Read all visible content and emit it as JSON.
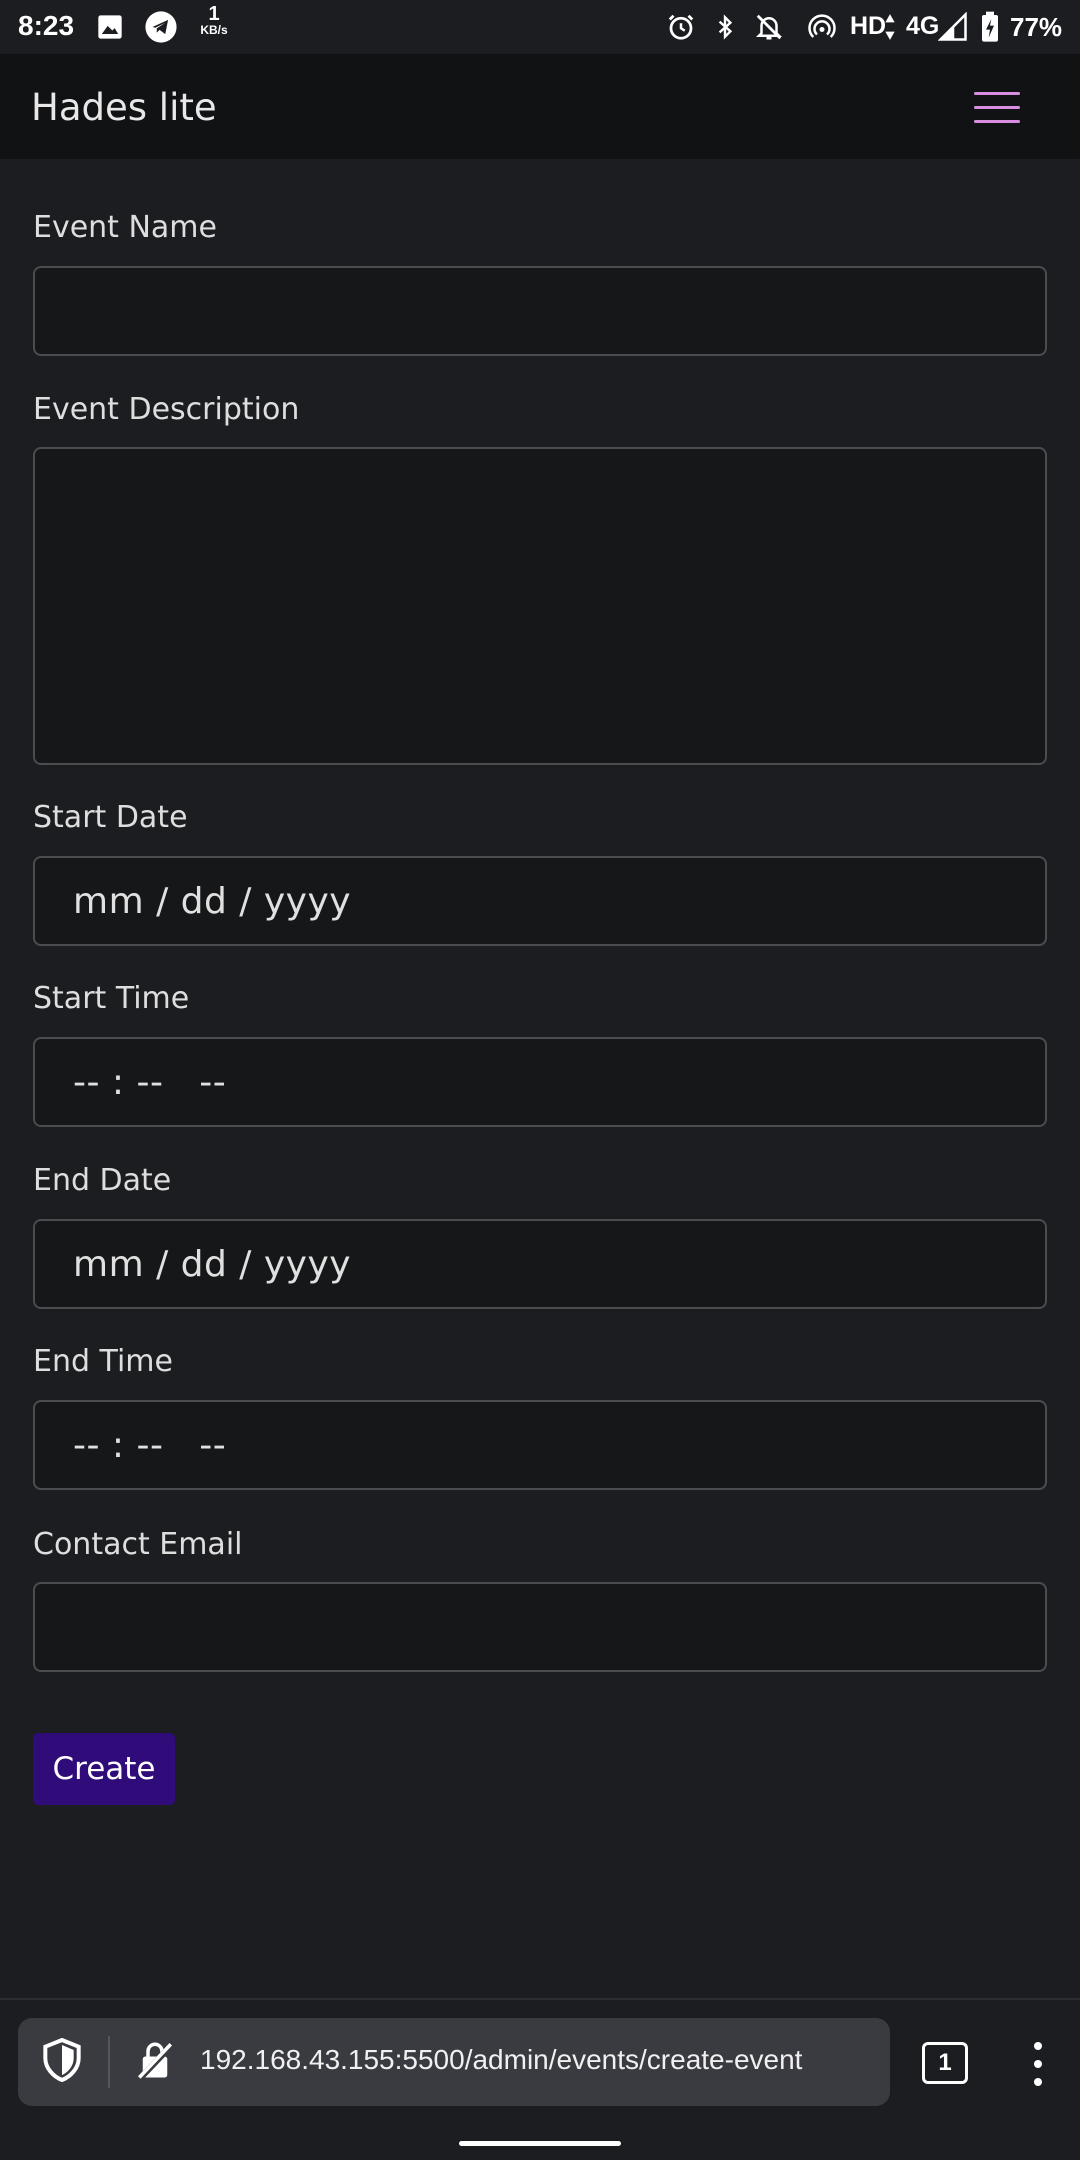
{
  "status_bar": {
    "time": "8:23",
    "net_speed_value": "1",
    "net_speed_unit": "KB/s",
    "hd": "HD",
    "network": "4G",
    "battery": "77%",
    "icons": [
      "image-icon",
      "telegram-icon",
      "alarm-icon",
      "bluetooth-icon",
      "bell-off-icon",
      "hotspot-icon",
      "signal-icon",
      "battery-charging-icon"
    ]
  },
  "app_bar": {
    "brand": "Hades lite",
    "menu_icon": "hamburger-icon",
    "menu_color": "#d98ee0"
  },
  "form": {
    "event_name": {
      "label": "Event Name",
      "value": ""
    },
    "event_description": {
      "label": "Event Description",
      "value": ""
    },
    "start_date": {
      "label": "Start Date",
      "placeholder": "mm / dd / yyyy"
    },
    "start_time": {
      "label": "Start Time",
      "placeholder": "-- : --   --"
    },
    "end_date": {
      "label": "End Date",
      "placeholder": "mm / dd / yyyy"
    },
    "end_time": {
      "label": "End Time",
      "placeholder": "-- : --   --"
    },
    "contact_email": {
      "label": "Contact Email",
      "value": ""
    },
    "submit_label": "Create",
    "submit_color": "#300b7a"
  },
  "browser": {
    "url": "192.168.43.155:5500/admin/events/create-event",
    "tab_count": "1",
    "shield_icon": "shield-icon",
    "insecure_icon": "insecure-lock-icon",
    "menu_icon": "more-vert-icon"
  }
}
